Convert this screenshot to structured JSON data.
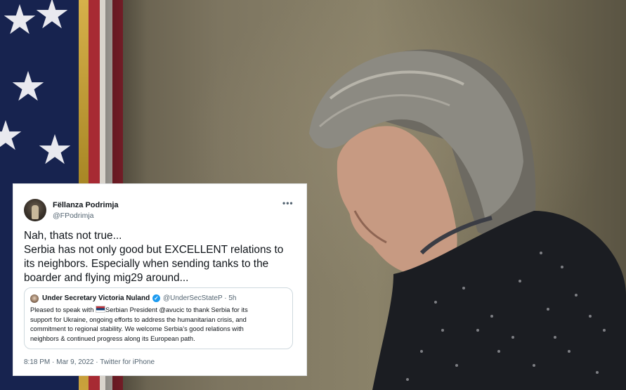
{
  "tweet": {
    "display_name": "Fëllanza Podrimja",
    "handle": "@FPodrimja",
    "more_icon": "more-horizontal-icon",
    "text_lines": [
      "Nah, thats not true...",
      "Serbia has not only good but EXCELLENT relations to",
      "its neighbors. Especially when sending tanks to the",
      "boarder and flying mig29 around..."
    ],
    "timestamp": "8:18 PM · Mar 9, 2022",
    "source": "Twitter for iPhone"
  },
  "quoted_tweet": {
    "display_name": "Under Secretary Victoria Nuland",
    "verified_icon": "verified-badge-icon",
    "handle_time": "@UnderSecStateP · 5h",
    "line1_before": "Pleased to speak with ",
    "flag_icon": "serbia-flag-icon",
    "line1_after": "Serbian President @avucic to thank Serbia for its",
    "lines": [
      "support for Ukraine, ongoing efforts to address the humanitarian crisis, and",
      "commitment to regional stability. We welcome Serbia’s good relations with",
      "neighbors & continued progress along its European path."
    ]
  },
  "colors": {
    "tweet_background": "#ffffff",
    "text": "#0f1419",
    "secondary_text": "#536471",
    "verified": "#1d9bf0"
  }
}
